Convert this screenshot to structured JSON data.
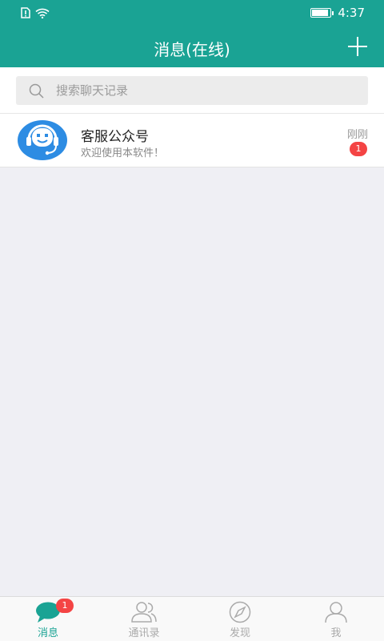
{
  "status_bar": {
    "time": "4:37",
    "battery_level": 0.95
  },
  "header": {
    "title": "消息(在线)"
  },
  "search": {
    "placeholder": "搜索聊天记录"
  },
  "conversations": [
    {
      "name": "客服公众号",
      "last_message": "欢迎使用本软件！",
      "time": "刚刚",
      "unread": "1"
    }
  ],
  "tabs": [
    {
      "label": "消息",
      "badge": "1",
      "active": true
    },
    {
      "label": "通讯录"
    },
    {
      "label": "发现"
    },
    {
      "label": "我"
    }
  ],
  "colors": {
    "primary": "#1aa394",
    "badge": "#f44444",
    "avatar_bg": "#2d8ce3"
  }
}
